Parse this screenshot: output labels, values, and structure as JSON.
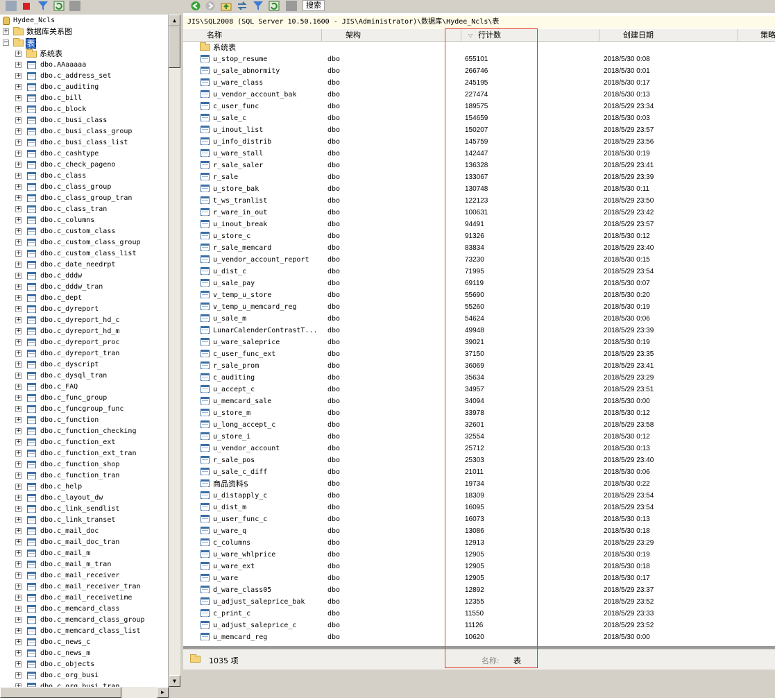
{
  "left_tree": {
    "database": "Hydee_Ncls",
    "diagrams": "数据库关系图",
    "tables_folder": "表",
    "system_tables": "系统表",
    "tables": [
      "dbo.AAaaaaa",
      "dbo.c_address_set",
      "dbo.c_auditing",
      "dbo.c_bill",
      "dbo.c_block",
      "dbo.c_busi_class",
      "dbo.c_busi_class_group",
      "dbo.c_busi_class_list",
      "dbo.c_cashtype",
      "dbo.c_check_pageno",
      "dbo.c_class",
      "dbo.c_class_group",
      "dbo.c_class_group_tran",
      "dbo.c_class_tran",
      "dbo.c_columns",
      "dbo.c_custom_class",
      "dbo.c_custom_class_group",
      "dbo.c_custom_class_list",
      "dbo.c_date_needrpt",
      "dbo.c_dddw",
      "dbo.c_dddw_tran",
      "dbo.c_dept",
      "dbo.c_dyreport",
      "dbo.c_dyreport_hd_c",
      "dbo.c_dyreport_hd_m",
      "dbo.c_dyreport_proc",
      "dbo.c_dyreport_tran",
      "dbo.c_dyscript",
      "dbo.c_dysql_tran",
      "dbo.c_FAQ",
      "dbo.c_func_group",
      "dbo.c_funcgroup_func",
      "dbo.c_function",
      "dbo.c_function_checking",
      "dbo.c_function_ext",
      "dbo.c_function_ext_tran",
      "dbo.c_function_shop",
      "dbo.c_function_tran",
      "dbo.c_help",
      "dbo.c_layout_dw",
      "dbo.c_link_sendlist",
      "dbo.c_link_transet",
      "dbo.c_mail_doc",
      "dbo.c_mail_doc_tran",
      "dbo.c_mail_m",
      "dbo.c_mail_m_tran",
      "dbo.c_mail_receiver",
      "dbo.c_mail_receiver_tran",
      "dbo.c_mail_receivetime",
      "dbo.c_memcard_class",
      "dbo.c_memcard_class_group",
      "dbo.c_memcard_class_list",
      "dbo.c_news_c",
      "dbo.c_news_m",
      "dbo.c_objects",
      "dbo.c_org_busi",
      "dbo.c_org_busi_tran"
    ]
  },
  "toolbar": {
    "search_label": "搜索"
  },
  "path": "JIS\\SQL2008 (SQL Server 10.50.1600 - JIS\\Administrator)\\数据库\\Hydee_Ncls\\表",
  "columns": {
    "name": "名称",
    "schema": "架构",
    "row_count": "行计数",
    "created": "创建日期",
    "policy": "策略"
  },
  "system_folder_row": "系统表",
  "rows": [
    {
      "name": "u_stop_resume",
      "schema": "dbo",
      "count": "655101",
      "date": "2018/5/30 0:08"
    },
    {
      "name": "u_sale_abnormity",
      "schema": "dbo",
      "count": "266746",
      "date": "2018/5/30 0:01"
    },
    {
      "name": "u_ware_class",
      "schema": "dbo",
      "count": "245195",
      "date": "2018/5/30 0:17"
    },
    {
      "name": "u_vendor_account_bak",
      "schema": "dbo",
      "count": "227474",
      "date": "2018/5/30 0:13"
    },
    {
      "name": "c_user_func",
      "schema": "dbo",
      "count": "189575",
      "date": "2018/5/29 23:34"
    },
    {
      "name": "u_sale_c",
      "schema": "dbo",
      "count": "154659",
      "date": "2018/5/30 0:03"
    },
    {
      "name": "u_inout_list",
      "schema": "dbo",
      "count": "150207",
      "date": "2018/5/29 23:57"
    },
    {
      "name": "u_info_distrib",
      "schema": "dbo",
      "count": "145759",
      "date": "2018/5/29 23:56"
    },
    {
      "name": "u_ware_stall",
      "schema": "dbo",
      "count": "142447",
      "date": "2018/5/30 0:19"
    },
    {
      "name": "r_sale_saler",
      "schema": "dbo",
      "count": "136328",
      "date": "2018/5/29 23:41"
    },
    {
      "name": "r_sale",
      "schema": "dbo",
      "count": "133067",
      "date": "2018/5/29 23:39"
    },
    {
      "name": "u_store_bak",
      "schema": "dbo",
      "count": "130748",
      "date": "2018/5/30 0:11"
    },
    {
      "name": "t_ws_tranlist",
      "schema": "dbo",
      "count": "122123",
      "date": "2018/5/29 23:50"
    },
    {
      "name": "r_ware_in_out",
      "schema": "dbo",
      "count": "100631",
      "date": "2018/5/29 23:42"
    },
    {
      "name": "u_inout_break",
      "schema": "dbo",
      "count": "94491",
      "date": "2018/5/29 23:57"
    },
    {
      "name": "u_store_c",
      "schema": "dbo",
      "count": "91326",
      "date": "2018/5/30 0:12"
    },
    {
      "name": "r_sale_memcard",
      "schema": "dbo",
      "count": "83834",
      "date": "2018/5/29 23:40"
    },
    {
      "name": "u_vendor_account_report",
      "schema": "dbo",
      "count": "73230",
      "date": "2018/5/30 0:15"
    },
    {
      "name": "u_dist_c",
      "schema": "dbo",
      "count": "71995",
      "date": "2018/5/29 23:54"
    },
    {
      "name": "u_sale_pay",
      "schema": "dbo",
      "count": "69119",
      "date": "2018/5/30 0:07"
    },
    {
      "name": "v_temp_u_store",
      "schema": "dbo",
      "count": "55690",
      "date": "2018/5/30 0:20"
    },
    {
      "name": "v_temp_u_memcard_reg",
      "schema": "dbo",
      "count": "55260",
      "date": "2018/5/30 0:19"
    },
    {
      "name": "u_sale_m",
      "schema": "dbo",
      "count": "54624",
      "date": "2018/5/30 0:06"
    },
    {
      "name": "LunarCalenderContrastT...",
      "schema": "dbo",
      "count": "49948",
      "date": "2018/5/29 23:39"
    },
    {
      "name": "u_ware_saleprice",
      "schema": "dbo",
      "count": "39021",
      "date": "2018/5/30 0:19"
    },
    {
      "name": "c_user_func_ext",
      "schema": "dbo",
      "count": "37150",
      "date": "2018/5/29 23:35"
    },
    {
      "name": "r_sale_prom",
      "schema": "dbo",
      "count": "36069",
      "date": "2018/5/29 23:41"
    },
    {
      "name": "c_auditing",
      "schema": "dbo",
      "count": "35634",
      "date": "2018/5/29 23:29"
    },
    {
      "name": "u_accept_c",
      "schema": "dbo",
      "count": "34957",
      "date": "2018/5/29 23:51"
    },
    {
      "name": "u_memcard_sale",
      "schema": "dbo",
      "count": "34094",
      "date": "2018/5/30 0:00"
    },
    {
      "name": "u_store_m",
      "schema": "dbo",
      "count": "33978",
      "date": "2018/5/30 0:12"
    },
    {
      "name": "u_long_accept_c",
      "schema": "dbo",
      "count": "32601",
      "date": "2018/5/29 23:58"
    },
    {
      "name": "u_store_i",
      "schema": "dbo",
      "count": "32554",
      "date": "2018/5/30 0:12"
    },
    {
      "name": "u_vendor_account",
      "schema": "dbo",
      "count": "25712",
      "date": "2018/5/30 0:13"
    },
    {
      "name": "r_sale_pos",
      "schema": "dbo",
      "count": "25303",
      "date": "2018/5/29 23:40"
    },
    {
      "name": "u_sale_c_diff",
      "schema": "dbo",
      "count": "21011",
      "date": "2018/5/30 0:06"
    },
    {
      "name": "商品资料$",
      "schema": "dbo",
      "count": "19734",
      "date": "2018/5/30 0:22"
    },
    {
      "name": "u_distapply_c",
      "schema": "dbo",
      "count": "18309",
      "date": "2018/5/29 23:54"
    },
    {
      "name": "u_dist_m",
      "schema": "dbo",
      "count": "16095",
      "date": "2018/5/29 23:54"
    },
    {
      "name": "u_user_func_c",
      "schema": "dbo",
      "count": "16073",
      "date": "2018/5/30 0:13"
    },
    {
      "name": "u_ware_q",
      "schema": "dbo",
      "count": "13086",
      "date": "2018/5/30 0:18"
    },
    {
      "name": "c_columns",
      "schema": "dbo",
      "count": "12913",
      "date": "2018/5/29 23:29"
    },
    {
      "name": "u_ware_whlprice",
      "schema": "dbo",
      "count": "12905",
      "date": "2018/5/30 0:19"
    },
    {
      "name": "u_ware_ext",
      "schema": "dbo",
      "count": "12905",
      "date": "2018/5/30 0:18"
    },
    {
      "name": "u_ware",
      "schema": "dbo",
      "count": "12905",
      "date": "2018/5/30 0:17"
    },
    {
      "name": "d_ware_class05",
      "schema": "dbo",
      "count": "12892",
      "date": "2018/5/29 23:37"
    },
    {
      "name": "u_adjust_saleprice_bak",
      "schema": "dbo",
      "count": "12355",
      "date": "2018/5/29 23:52"
    },
    {
      "name": "c_print_c",
      "schema": "dbo",
      "count": "11550",
      "date": "2018/5/29 23:33"
    },
    {
      "name": "u_adjust_saleprice_c",
      "schema": "dbo",
      "count": "11126",
      "date": "2018/5/29 23:52"
    },
    {
      "name": "u_memcard_reg",
      "schema": "dbo",
      "count": "10620",
      "date": "2018/5/30 0:00"
    }
  ],
  "status": {
    "count": "1035 项",
    "name_label": "名称:",
    "name_value": "表"
  },
  "colors": {
    "highlight_border": "#e03a2e",
    "path_bg": "#fffbe9"
  }
}
